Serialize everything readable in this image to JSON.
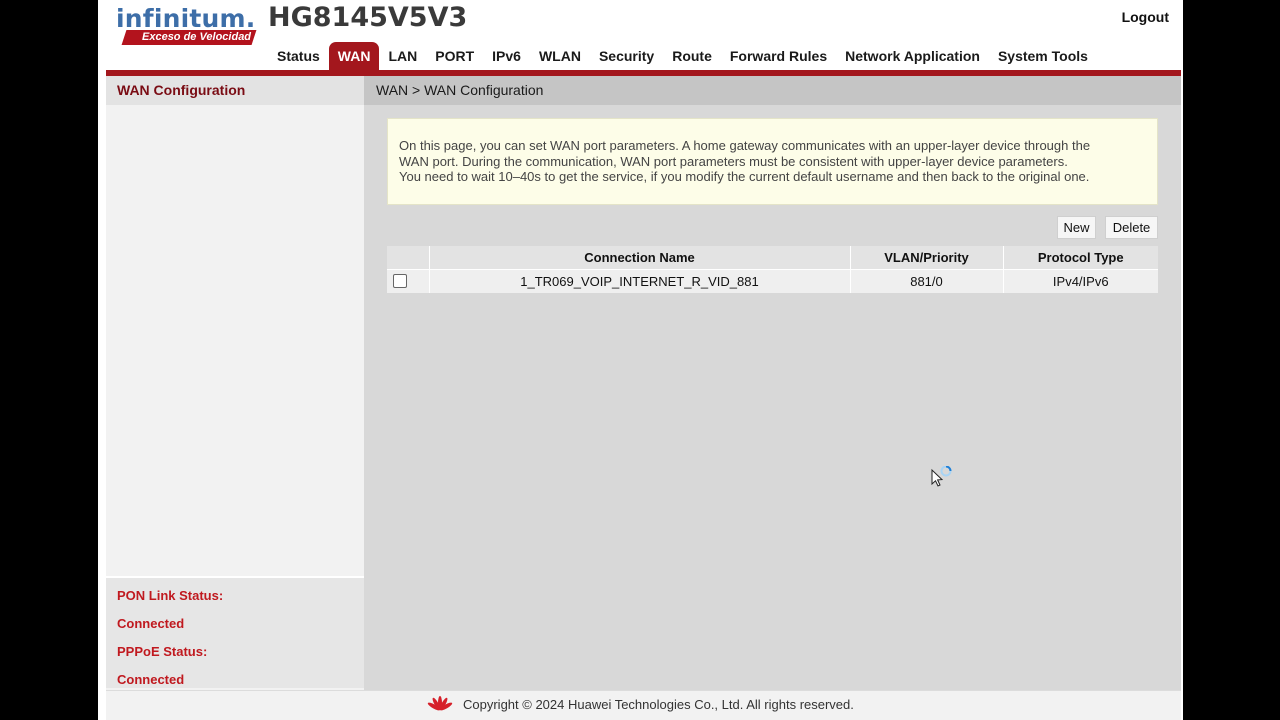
{
  "brand": {
    "logo_main": "infinitum.",
    "logo_sub": "Exceso de Velocidad",
    "model": "HG8145V5V3"
  },
  "header": {
    "logout_label": "Logout"
  },
  "nav": {
    "items": [
      {
        "label": "Status"
      },
      {
        "label": "WAN",
        "active": true
      },
      {
        "label": "LAN"
      },
      {
        "label": "PORT"
      },
      {
        "label": "IPv6"
      },
      {
        "label": "WLAN"
      },
      {
        "label": "Security"
      },
      {
        "label": "Route"
      },
      {
        "label": "Forward Rules"
      },
      {
        "label": "Network Application"
      },
      {
        "label": "System Tools"
      }
    ]
  },
  "sidebar": {
    "active_item": "WAN Configuration",
    "status": {
      "pon_label": "PON Link Status:",
      "pon_value": "Connected",
      "pppoe_label": "PPPoE Status:",
      "pppoe_value": "Connected"
    }
  },
  "main": {
    "breadcrumb": "WAN > WAN Configuration",
    "notice": {
      "line1": "On this page, you can set WAN port parameters. A home gateway communicates with an upper-layer device through the",
      "line2": "WAN port. During the communication, WAN port parameters must be consistent with upper-layer device parameters.",
      "line3": "You need to wait 10–40s to get the service, if you modify the current default username and then back to the original one."
    },
    "buttons": {
      "new_label": "New",
      "delete_label": "Delete"
    },
    "table": {
      "headers": [
        "",
        "Connection Name",
        "VLAN/Priority",
        "Protocol Type"
      ],
      "rows": [
        {
          "checked": false,
          "name": "1_TR069_VOIP_INTERNET_R_VID_881",
          "vlan": "881/0",
          "protocol": "IPv4/IPv6"
        }
      ]
    }
  },
  "footer": {
    "copyright": "Copyright © 2024 Huawei Technologies Co., Ltd. All rights reserved."
  },
  "colors": {
    "brand_red": "#a3171d",
    "logo_blue": "#3d6ea8",
    "status_red": "#c0191f",
    "notice_bg": "#fdfde8"
  },
  "icons": {
    "cursor": "busy-cursor-icon",
    "footer_logo": "huawei-logo-icon"
  }
}
